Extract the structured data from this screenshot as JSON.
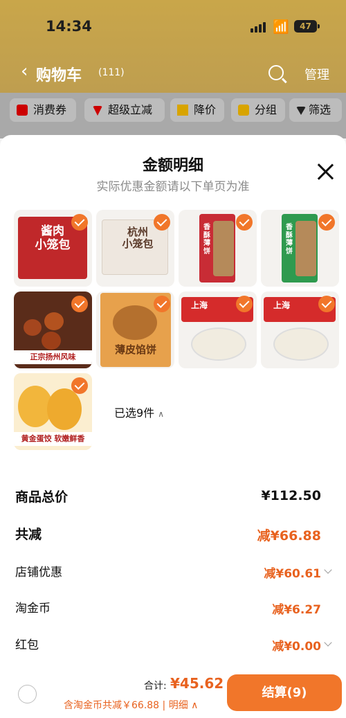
{
  "status_bar": {
    "time": "14:34",
    "battery": "47"
  },
  "navbar": {
    "title": "购物车",
    "count": "(111)",
    "manage": "管理"
  },
  "filters": [
    {
      "label": "消费券"
    },
    {
      "label": "超级立减"
    },
    {
      "label": "降价"
    },
    {
      "label": "分组"
    },
    {
      "label": "筛选"
    }
  ],
  "sheet": {
    "title": "金额明细",
    "subtitle": "实际优惠金额请以下单页为准",
    "products": [
      {
        "name": "酱肉小笼包",
        "pkg_text": "酱肉\n小笼包",
        "color": "#c0282a"
      },
      {
        "name": "杭州小笼包",
        "pkg_text": "杭州\n小笼包",
        "color": "#eee7df"
      },
      {
        "name": "香酥薄饼",
        "pkg_text": "香酥薄饼",
        "color": "#c82c35"
      },
      {
        "name": "香酥薄饼绿",
        "pkg_text": "香酥薄饼",
        "color": "#2f9a4f"
      },
      {
        "name": "正宗扬州风味",
        "caption": "正宗扬州风味",
        "color": "#7a3a1c"
      },
      {
        "name": "薄皮馅饼",
        "pkg_text": "薄皮馅饼",
        "color": "#e7a14c"
      },
      {
        "name": "上海馄饨1",
        "pkg_text": "上海",
        "color": "#d52b2b"
      },
      {
        "name": "上海馄饨2",
        "pkg_text": "上海",
        "color": "#d52b2b"
      },
      {
        "name": "黄金蛋饺",
        "caption": "黄金蛋饺 软嫩鲜香",
        "color": "#f2b63c"
      }
    ],
    "selected_text": "已选9件",
    "rows": [
      {
        "label": "商品总价",
        "value": "¥112.50"
      },
      {
        "label": "共减",
        "value": "减¥66.88"
      },
      {
        "label": "店铺优惠",
        "value": "减¥60.61"
      },
      {
        "label": "淘金币",
        "value": "减¥6.27"
      },
      {
        "label": "红包",
        "value": "减¥0.00"
      }
    ]
  },
  "footer": {
    "total_label": "合计:",
    "total_value": "¥45.62",
    "savings_text": "含淘金币共减￥66.88 | 明细",
    "checkout_label": "结算(9)"
  },
  "colors": {
    "accent": "#f1762a",
    "discount": "#e8621f"
  }
}
